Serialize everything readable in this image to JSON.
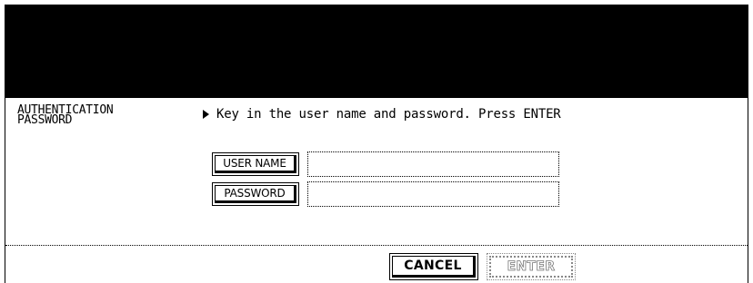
{
  "screen": {
    "title_line1": "AUTHENTICATION",
    "title_line2": "PASSWORD",
    "message": "Key in the user name and password. Press ENTER"
  },
  "form": {
    "user_name_label": "USER NAME",
    "user_name_value": "",
    "password_label": "PASSWORD",
    "password_value": ""
  },
  "footer": {
    "cancel_label": "CANCEL",
    "enter_label": "ENTER"
  }
}
